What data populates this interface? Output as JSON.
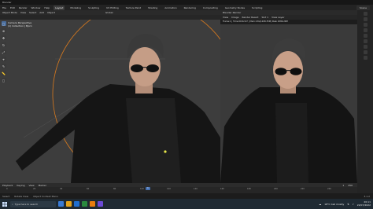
{
  "app": {
    "title": "Blender"
  },
  "menu": {
    "items": [
      "File",
      "Edit",
      "Render",
      "Window",
      "Help"
    ],
    "tabs": [
      "Layout",
      "Modeling",
      "Sculpting",
      "UV Editing",
      "Texture Paint",
      "Shading",
      "Animation",
      "Rendering",
      "Compositing",
      "Geometry Nodes",
      "Scripting"
    ],
    "active_tab": "Layout",
    "scene": "Scene"
  },
  "viewport": {
    "mode": "Object Mode",
    "header_items": [
      "View",
      "Select",
      "Add",
      "Object"
    ],
    "transform": "Global",
    "info_line1": "Camera Perspective",
    "info_line2": "(1) Collection | Bjorn"
  },
  "render_window": {
    "title": "Blender Render",
    "menu": [
      "View",
      "Image"
    ],
    "image_name": "Render Result",
    "slot": "Slot 1",
    "layer": "View Layer",
    "info": "Frame:1 | Time:00:02.67 | Mem:13G(1268.35M) Peak 2086.29M"
  },
  "timeline": {
    "menu": [
      "Playback",
      "Keying",
      "View",
      "Marker"
    ],
    "ticks": [
      "0",
      "20",
      "40",
      "60",
      "80",
      "100",
      "120",
      "140",
      "160",
      "180",
      "200",
      "220",
      "240"
    ],
    "current_frame": "1",
    "start": "1",
    "end": "250"
  },
  "statusbar": {
    "items": [
      "Select",
      "Rotate View",
      "Object Context Menu"
    ],
    "version": "3.1.2"
  },
  "taskbar": {
    "search_placeholder": "Type here to search",
    "weather": "18°C  Cell mostly",
    "time": "20:11",
    "date": "22/07/2022"
  },
  "colors": {
    "accent": "#4772b3",
    "camera_circle": "#d97a1e",
    "jacket": "#141414",
    "skin": "#c59d86",
    "hair": "#3a3a3a",
    "render_bg": "#3a3a3a"
  }
}
